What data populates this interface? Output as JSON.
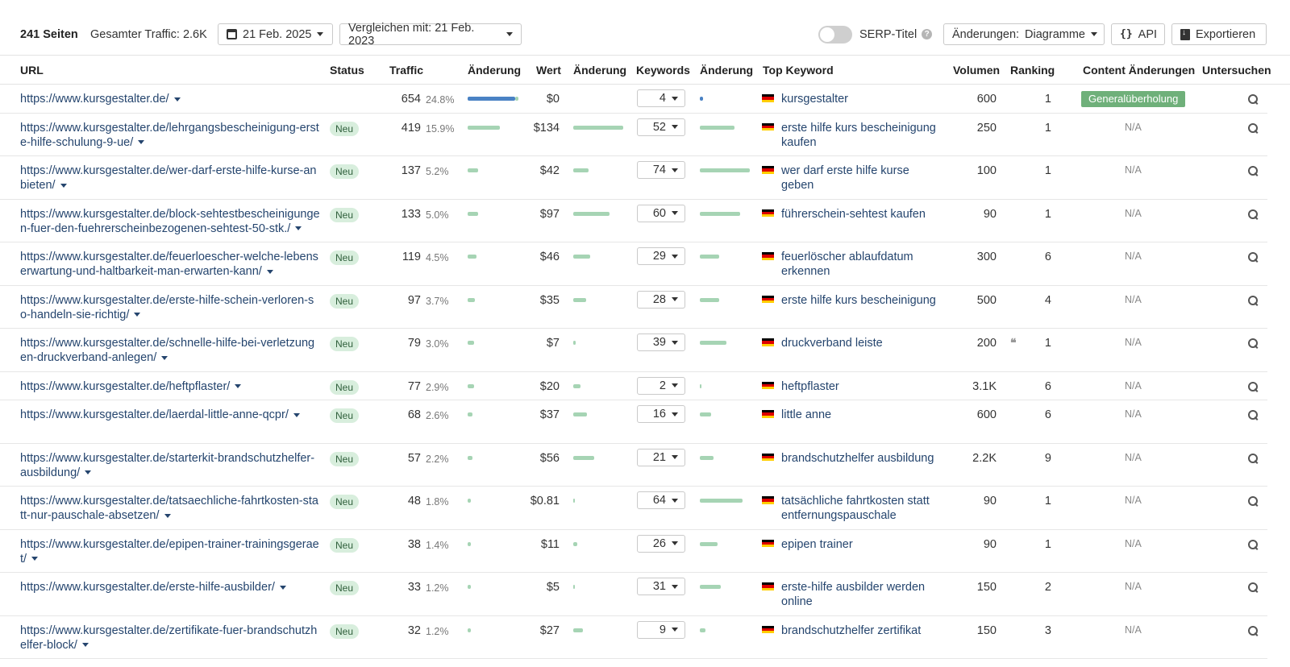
{
  "toolbar": {
    "title": "241 Seiten",
    "traffic": "Gesamter Traffic: 2.6K",
    "date": "21 Feb. 2025",
    "compare": "Vergleichen mit: 21 Feb. 2023",
    "serp_label": "SERP-Titel",
    "serp_help": "?",
    "changes_label": "Änderungen:",
    "changes_value": "Diagramme",
    "api_label": "API",
    "export_label": "Exportieren"
  },
  "columns": {
    "url": "URL",
    "status": "Status",
    "traffic": "Traffic",
    "traffic_change": "Änderung",
    "value": "Wert",
    "value_change": "Änderung",
    "keywords": "Keywords",
    "keywords_change": "Änderung",
    "top_keyword": "Top Keyword",
    "volume": "Volumen",
    "ranking": "Ranking",
    "content_changes": "Content Änderungen",
    "inspect": "Untersuchen"
  },
  "colors": {
    "link": "#25456e",
    "bar_green": "#a6d4b4",
    "bar_blue": "#4a82c4",
    "badge_bg": "#d8eedd",
    "content_badge": "#6fb07a"
  },
  "rows": [
    {
      "url": "https://www.kursgestalter.de/",
      "status": "",
      "traffic": "654",
      "pct": "24.8%",
      "traffic_bar": 1.0,
      "value": "$0",
      "value_bar": 0,
      "keywords": "4",
      "kw_bar": 0.06,
      "keyword": "kursgestalter",
      "volume": "600",
      "quote": "",
      "ranking": "1",
      "content": "Generalüberholung",
      "na": ""
    },
    {
      "url": "https://www.kursgestalter.de/lehrgangsbescheinigung-erste-hilfe-schulung-9-ue/",
      "status": "Neu",
      "traffic": "419",
      "pct": "15.9%",
      "traffic_bar": 0.64,
      "value": "$134",
      "value_bar": 1.0,
      "keywords": "52",
      "kw_bar": 0.7,
      "keyword": "erste hilfe kurs bescheinigung kaufen",
      "volume": "250",
      "quote": "",
      "ranking": "1",
      "content": "",
      "na": "N/A"
    },
    {
      "url": "https://www.kursgestalter.de/wer-darf-erste-hilfe-kurse-anbieten/",
      "status": "Neu",
      "traffic": "137",
      "pct": "5.2%",
      "traffic_bar": 0.21,
      "value": "$42",
      "value_bar": 0.31,
      "keywords": "74",
      "kw_bar": 1.0,
      "keyword": "wer darf erste hilfe kurse geben",
      "volume": "100",
      "quote": "",
      "ranking": "1",
      "content": "",
      "na": "N/A"
    },
    {
      "url": "https://www.kursgestalter.de/block-sehtestbescheinigungen-fuer-den-fuehrerscheinbezogenen-sehtest-50-stk./",
      "status": "Neu",
      "traffic": "133",
      "pct": "5.0%",
      "traffic_bar": 0.2,
      "value": "$97",
      "value_bar": 0.72,
      "keywords": "60",
      "kw_bar": 0.81,
      "keyword": "führerschein-sehtest kaufen",
      "volume": "90",
      "quote": "",
      "ranking": "1",
      "content": "",
      "na": "N/A"
    },
    {
      "url": "https://www.kursgestalter.de/feuerloescher-welche-lebenserwartung-und-haltbarkeit-man-erwarten-kann/",
      "status": "Neu",
      "traffic": "119",
      "pct": "4.5%",
      "traffic_bar": 0.18,
      "value": "$46",
      "value_bar": 0.34,
      "keywords": "29",
      "kw_bar": 0.39,
      "keyword": "feuerlöscher ablaufdatum erkennen",
      "volume": "300",
      "quote": "",
      "ranking": "6",
      "content": "",
      "na": "N/A"
    },
    {
      "url": "https://www.kursgestalter.de/erste-hilfe-schein-verloren-so-handeln-sie-richtig/",
      "status": "Neu",
      "traffic": "97",
      "pct": "3.7%",
      "traffic_bar": 0.15,
      "value": "$35",
      "value_bar": 0.26,
      "keywords": "28",
      "kw_bar": 0.38,
      "keyword": "erste hilfe kurs bescheinigung",
      "volume": "500",
      "quote": "",
      "ranking": "4",
      "content": "",
      "na": "N/A"
    },
    {
      "url": "https://www.kursgestalter.de/schnelle-hilfe-bei-verletzungen-druckverband-anlegen/",
      "status": "Neu",
      "traffic": "79",
      "pct": "3.0%",
      "traffic_bar": 0.12,
      "value": "$7",
      "value_bar": 0.05,
      "keywords": "39",
      "kw_bar": 0.53,
      "keyword": "druckverband leiste",
      "volume": "200",
      "quote": "❝",
      "ranking": "1",
      "content": "",
      "na": "N/A"
    },
    {
      "url": "https://www.kursgestalter.de/heftpflaster/",
      "status": "Neu",
      "traffic": "77",
      "pct": "2.9%",
      "traffic_bar": 0.12,
      "value": "$20",
      "value_bar": 0.15,
      "keywords": "2",
      "kw_bar": 0.03,
      "keyword": "heftpflaster",
      "volume": "3.1K",
      "quote": "",
      "ranking": "6",
      "content": "",
      "na": "N/A"
    },
    {
      "url": "https://www.kursgestalter.de/laerdal-little-anne-qcpr/",
      "status": "Neu",
      "traffic": "68",
      "pct": "2.6%",
      "traffic_bar": 0.1,
      "value": "$37",
      "value_bar": 0.28,
      "keywords": "16",
      "kw_bar": 0.22,
      "keyword": "little anne",
      "volume": "600",
      "quote": "",
      "ranking": "6",
      "content": "",
      "na": "N/A"
    },
    {
      "url": "https://www.kursgestalter.de/starterkit-brandschutzhelfer-ausbildung/",
      "status": "Neu",
      "traffic": "57",
      "pct": "2.2%",
      "traffic_bar": 0.09,
      "value": "$56",
      "value_bar": 0.42,
      "keywords": "21",
      "kw_bar": 0.28,
      "keyword": "brandschutzhelfer ausbildung",
      "volume": "2.2K",
      "quote": "",
      "ranking": "9",
      "content": "",
      "na": "N/A"
    },
    {
      "url": "https://www.kursgestalter.de/tatsaechliche-fahrtkosten-statt-nur-pauschale-absetzen/",
      "status": "Neu",
      "traffic": "48",
      "pct": "1.8%",
      "traffic_bar": 0.07,
      "value": "$0.81",
      "value_bar": 0.01,
      "keywords": "64",
      "kw_bar": 0.86,
      "keyword": "tatsächliche fahrtkosten statt entfernungspauschale",
      "volume": "90",
      "quote": "",
      "ranking": "1",
      "content": "",
      "na": "N/A"
    },
    {
      "url": "https://www.kursgestalter.de/epipen-trainer-trainingsgeraet/",
      "status": "Neu",
      "traffic": "38",
      "pct": "1.4%",
      "traffic_bar": 0.06,
      "value": "$11",
      "value_bar": 0.08,
      "keywords": "26",
      "kw_bar": 0.35,
      "keyword": "epipen trainer",
      "volume": "90",
      "quote": "",
      "ranking": "1",
      "content": "",
      "na": "N/A"
    },
    {
      "url": "https://www.kursgestalter.de/erste-hilfe-ausbilder/",
      "status": "Neu",
      "traffic": "33",
      "pct": "1.2%",
      "traffic_bar": 0.05,
      "value": "$5",
      "value_bar": 0.04,
      "keywords": "31",
      "kw_bar": 0.42,
      "keyword": "erste-hilfe ausbilder werden online",
      "volume": "150",
      "quote": "",
      "ranking": "2",
      "content": "",
      "na": "N/A"
    },
    {
      "url": "https://www.kursgestalter.de/zertifikate-fuer-brandschutzhelfer-block/",
      "status": "Neu",
      "traffic": "32",
      "pct": "1.2%",
      "traffic_bar": 0.05,
      "value": "$27",
      "value_bar": 0.2,
      "keywords": "9",
      "kw_bar": 0.12,
      "keyword": "brandschutzhelfer zertifikat",
      "volume": "150",
      "quote": "",
      "ranking": "3",
      "content": "",
      "na": "N/A"
    }
  ]
}
